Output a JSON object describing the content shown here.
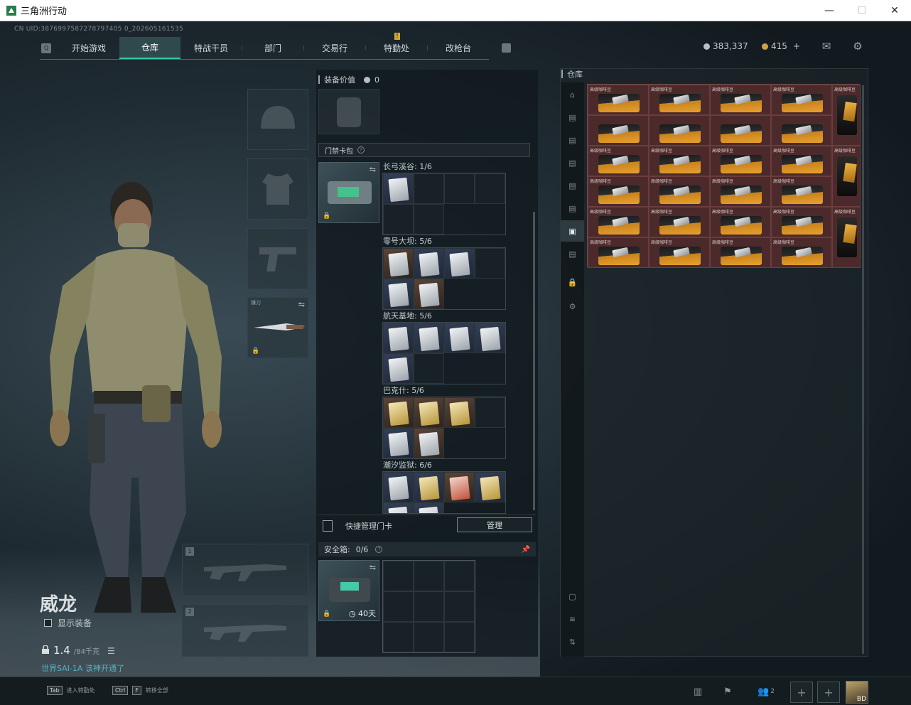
{
  "window": {
    "title": "三角洲行动",
    "minimize": "—",
    "maximize": "☐",
    "close": "✕"
  },
  "uid": "CN UID:3876997587278797405 0_202605161535",
  "nav": {
    "tabs": [
      {
        "label": "开始游戏",
        "active": false
      },
      {
        "label": "仓库",
        "active": true
      },
      {
        "label": "特战干员",
        "active": false
      },
      {
        "label": "部门",
        "active": false
      },
      {
        "label": "交易行",
        "active": false
      },
      {
        "label": "特勤处",
        "active": false
      },
      {
        "label": "改枪台",
        "active": false
      }
    ],
    "alert_badge": "!"
  },
  "currency": {
    "silver": "383,337",
    "gold": "415",
    "gold_add": "+"
  },
  "operator": {
    "name": "威龙",
    "show_equipment_label": "显示装备",
    "weight": "1.4",
    "weight_capacity": "/84千克",
    "note": "世界SAI-1A 该神开通了"
  },
  "equipment": {
    "melee_label": "镰刀",
    "weapon_slot_1": "1",
    "weapon_slot_2": "2"
  },
  "center": {
    "equip_value_label": "装备价值",
    "equip_value": "0",
    "keycard_pack_label": "门禁卡包",
    "help": "?",
    "maps": [
      {
        "label": "长弓溪谷: 1/6"
      },
      {
        "label": "零号大坝: 5/6"
      },
      {
        "label": "航天基地: 5/6"
      },
      {
        "label": "巴克什: 5/6"
      },
      {
        "label": "潮汐监狱: 6/6"
      }
    ],
    "quick_manage_label": "快捷管理门卡",
    "manage_button": "管理",
    "safebox_label": "安全箱:",
    "safebox_count": "0/6",
    "safebox_days": "40天"
  },
  "stash": {
    "title": "仓库",
    "bag_name": "高级咖啡豆"
  },
  "bottom": {
    "hint1_key": "Tab",
    "hint1_text": "进入特勤处",
    "hint2_key1": "Ctrl",
    "hint2_key2": "F",
    "hint2_text": "转移全部",
    "squad_count": "2",
    "avatar_label": "BD"
  },
  "colors": {
    "accent": "#36c6a3",
    "stash_bg": "#4a2c2e",
    "gold_coin": "#d0a048"
  }
}
